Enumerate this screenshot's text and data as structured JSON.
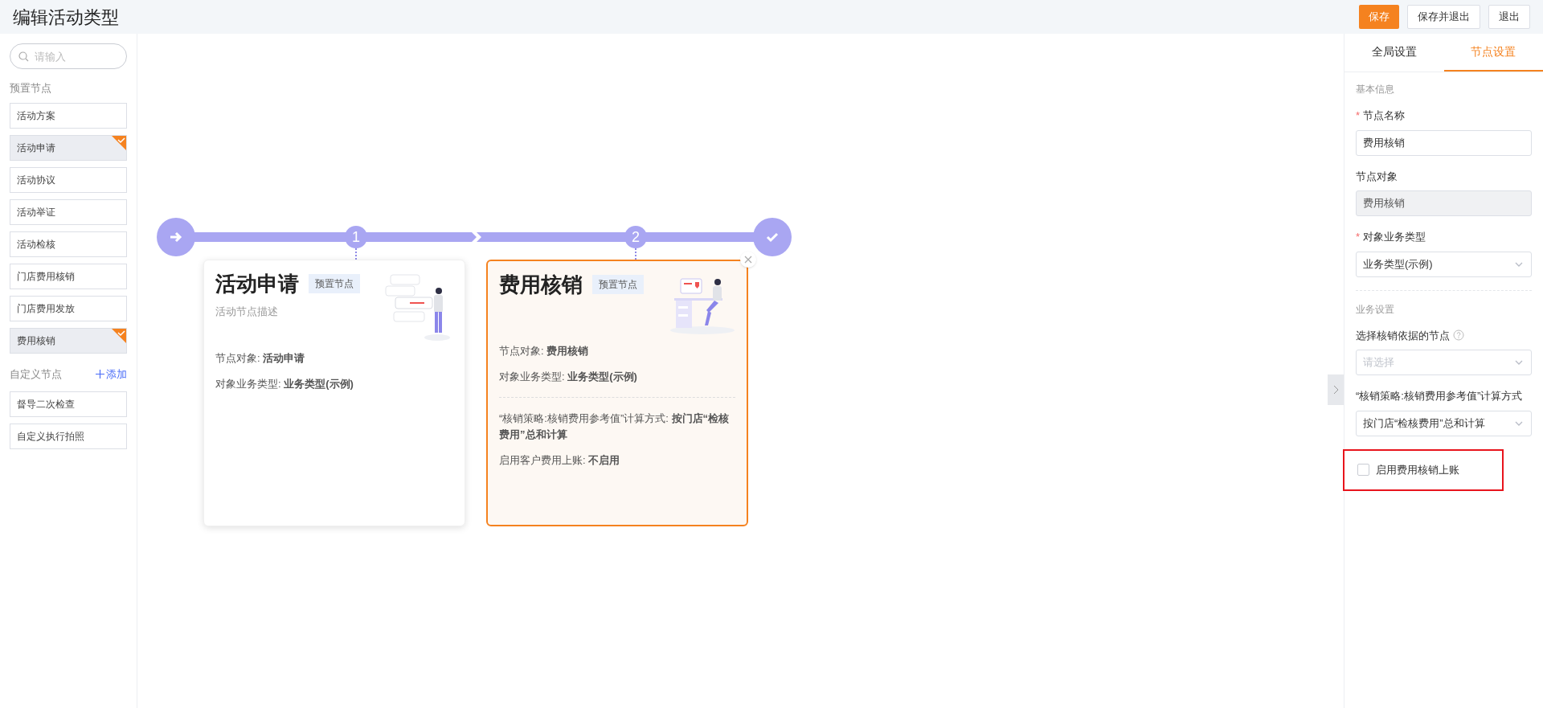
{
  "title": "编辑活动类型",
  "header_buttons": [
    {
      "label": "保存",
      "kind": "primary"
    },
    {
      "label": "保存并退出",
      "kind": "default"
    },
    {
      "label": "退出",
      "kind": "default"
    }
  ],
  "sidebar": {
    "search": {
      "placeholder": "请输入"
    },
    "preset_title": "预置节点",
    "preset_items": [
      {
        "label": "活动方案",
        "selected": false
      },
      {
        "label": "活动申请",
        "selected": true
      },
      {
        "label": "活动协议",
        "selected": false
      },
      {
        "label": "活动举证",
        "selected": false
      },
      {
        "label": "活动检核",
        "selected": false
      },
      {
        "label": "门店费用核销",
        "selected": false
      },
      {
        "label": "门店费用发放",
        "selected": false
      },
      {
        "label": "费用核销",
        "selected": true
      }
    ],
    "custom_title": "自定义节点",
    "add_link": "添加",
    "custom_items": [
      {
        "label": "督导二次检查",
        "selected": false
      },
      {
        "label": "自定义执行拍照",
        "selected": false
      }
    ]
  },
  "flow": {
    "steps": [
      "1",
      "2"
    ],
    "cards": [
      {
        "title": "活动申请",
        "badge": "预置节点",
        "description": "活动节点描述",
        "selected": false,
        "fields": [
          "节点对象: **活动申请**",
          "对象业务类型: **业务类型(示例)**"
        ]
      },
      {
        "title": "费用核销",
        "badge": "预置节点",
        "selected": true,
        "fields": [
          "节点对象: **费用核销**",
          "对象业务类型: **业务类型(示例)**"
        ],
        "extra_fields": [
          "“核销策略:核销费用参考值”计算方式: **按门店“检核费用”总和计算**",
          "启用客户费用上账: **不启用**"
        ]
      }
    ]
  },
  "panel": {
    "tabs": [
      {
        "label": "全局设置",
        "selected": false
      },
      {
        "label": "节点设置",
        "selected": true
      }
    ],
    "sections": [
      {
        "title": "基本信息",
        "items": [
          {
            "kind": "input",
            "required_mark": "*",
            "label": "节点名称",
            "value": "费用核销"
          },
          {
            "kind": "readonly",
            "label": "节点对象",
            "value": "费用核销"
          },
          {
            "kind": "select",
            "required_mark": "*",
            "label": "对象业务类型",
            "value": "业务类型(示例)"
          }
        ]
      },
      {
        "title": "业务设置",
        "items": [
          {
            "kind": "select",
            "label": "选择核销依据的节点",
            "help": true,
            "placeholder": "请选择"
          },
          {
            "kind": "select",
            "label": "“核销策略:核销费用参考值”计算方式",
            "value": "按门店“检核费用”总和计算"
          },
          {
            "kind": "checkbox",
            "label": "启用费用核销上账",
            "checked": false,
            "highlighted": true
          }
        ]
      }
    ]
  }
}
